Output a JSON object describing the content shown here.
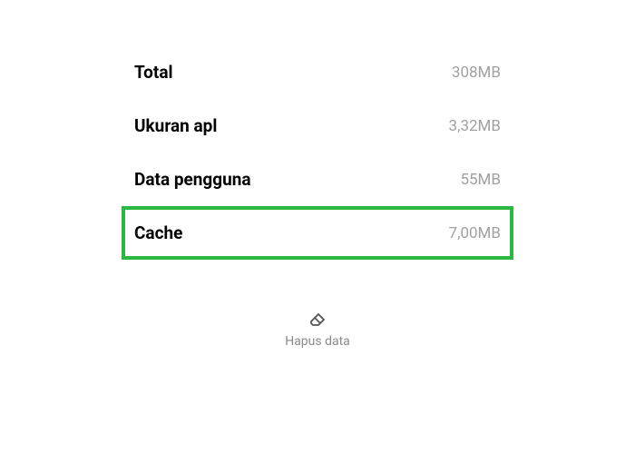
{
  "storage": {
    "total": {
      "label": "Total",
      "value": "308MB"
    },
    "app_size": {
      "label": "Ukuran apl",
      "value": "3,32MB"
    },
    "user_data": {
      "label": "Data pengguna",
      "value": "55MB"
    },
    "cache": {
      "label": "Cache",
      "value": "7,00MB"
    }
  },
  "actions": {
    "clear_data": {
      "label": "Hapus data"
    }
  },
  "highlight_color": "#2cb742"
}
